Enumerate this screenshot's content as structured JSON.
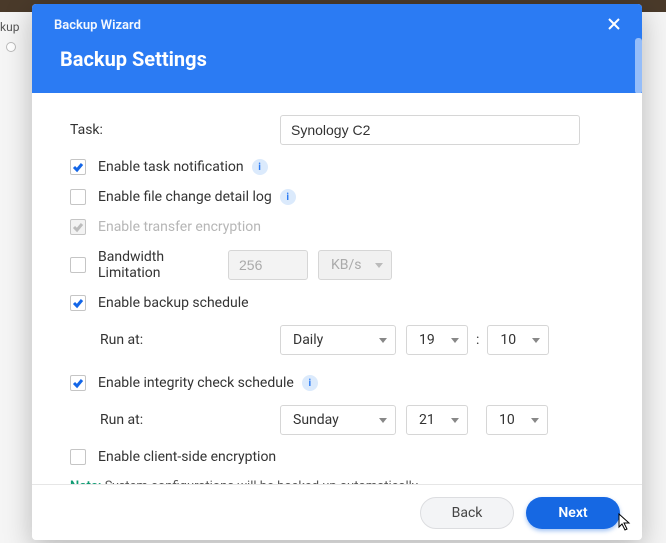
{
  "background": {
    "tab": "kup"
  },
  "header": {
    "wizard": "Backup Wizard",
    "title": "Backup Settings"
  },
  "form": {
    "task_label": "Task:",
    "task_value": "Synology C2",
    "opt_notify": "Enable task notification",
    "opt_changelog": "Enable file change detail log",
    "opt_encrypt_transfer": "Enable transfer encryption",
    "opt_bandwidth": "Bandwidth Limitation",
    "bandwidth_value": "256",
    "bandwidth_unit": "KB/s",
    "opt_schedule": "Enable backup schedule",
    "run_at": "Run at:",
    "schedule_freq": "Daily",
    "schedule_hour": "19",
    "schedule_min": "10",
    "colon": ":",
    "opt_integrity": "Enable integrity check schedule",
    "integrity_day": "Sunday",
    "integrity_hour": "21",
    "integrity_min": "10",
    "opt_client_encrypt": "Enable client-side encryption",
    "note_label": "Note:",
    "note_text": " System configurations will be backed up automatically."
  },
  "footer": {
    "back": "Back",
    "next": "Next"
  },
  "info_glyph": "i"
}
